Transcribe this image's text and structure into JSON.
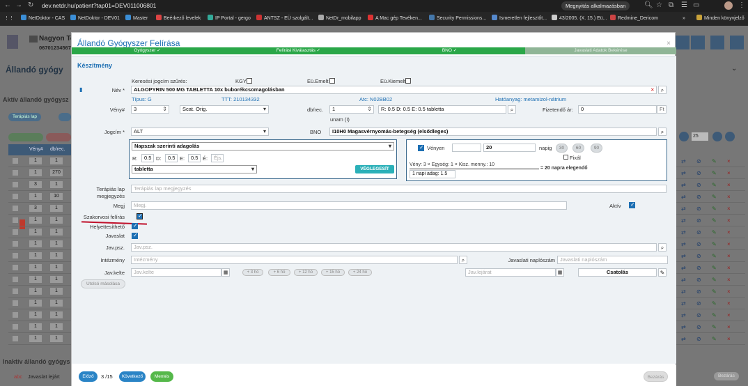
{
  "browser": {
    "url": "dev.netdr.hu/patient?tap01=DEV011006801",
    "open_in_app": "Megnyitás alkalmazásban",
    "bookmarks": [
      "NetDoktor - CAS",
      "NetDoktor - DEV01",
      "Master",
      "Beérkező levelek",
      "IP Portal - gergo",
      "ANTSZ - EÜ szolgált...",
      "NetDr_mobilapp",
      "A Mac gép Tevéken...",
      "Security Permissions...",
      "Ismeretlen fejlesztőt...",
      "43/2005. (X. 15.) Eü...",
      "Redmine_Dericom"
    ],
    "all_bookmarks": "Minden könyvjelző"
  },
  "bg": {
    "patient_name": "Nagyon Te",
    "patient_phone": "06701234567",
    "page_title": "Állandó gyógy",
    "section_title": "Aktív állandó gyógysz",
    "therapy_btn": "Terápiás lap",
    "col_veny": "Vény#",
    "col_db": "db/rec.",
    "inactive_title": "Inaktív állandó gyógys",
    "legend_abc": "abc",
    "legend_text": "Javaslat lejárt",
    "pagesize": "25",
    "close_btn": "Bezárás",
    "rows": [
      [
        "1",
        "1"
      ],
      [
        "1",
        "270"
      ],
      [
        "3",
        "1"
      ],
      [
        "1",
        "10"
      ],
      [
        "3",
        "1"
      ],
      [
        "1",
        "1"
      ],
      [
        "1",
        "1"
      ],
      [
        "1",
        "1"
      ],
      [
        "1",
        "1"
      ],
      [
        "1",
        "1"
      ],
      [
        "1",
        "1"
      ],
      [
        "1",
        "1"
      ],
      [
        "1",
        "1"
      ],
      [
        "1",
        "1"
      ],
      [
        "1",
        "1"
      ],
      [
        "1",
        "1"
      ]
    ]
  },
  "modal": {
    "title": "Állandó Gyógyszer Felírása",
    "close": "×",
    "steps": [
      "Gyógyszer ✓",
      "Felírási Kiválasztás ✓",
      "BNO ✓",
      "Javaslati Adatok Bekérése"
    ],
    "section": "Készítmény",
    "kereses_label": "Keresési jogcím szűrés:",
    "kgy": "KGY",
    "eu_emelt": "Eü.Emelt",
    "eu_kiemelt": "Eü.Kiemelt",
    "nev_label": "Név *",
    "nev_value": "ALGOPYRIN 500 MG TABLETTA 10x buborékcsomagolásban",
    "tipus": "Típus: G",
    "ttt": "TTT: 210134332",
    "atc": "Atc: N02BB02",
    "hatoanyag": "Hatóanyag: metamizol-nátrium",
    "veny_label": "Vény#",
    "veny_value": "3",
    "veny_type": "Scat. Orig.",
    "dbrec_label": "db/rec.",
    "dbrec_value": "1",
    "unam": "unam (I)",
    "adagolas_value": "R: 0.5 D: 0.5 E: 0.5 tabletta",
    "fizetendo_label": "Fizetendő ár:",
    "fizetendo_value": "0",
    "fizetendo_unit": "Ft",
    "jogcim_label": "Jogcím *",
    "jogcim_value": "ALT",
    "bno_label": "BNO",
    "bno_value": "I10H0 Magasvérnyomás-betegség (elsődleges)",
    "dosing": {
      "mode": "Napszak szerinti adagolás",
      "r_label": "R:",
      "r": "0.5",
      "d_label": "D:",
      "d": "0.5",
      "e_label": "E:",
      "e": "0.5",
      "e2_label": "É:",
      "e2_ph": "Éjs.",
      "unit": "tabletta",
      "finalize": "VÉGLEGESÍT"
    },
    "calc": {
      "venyen": "Vényen",
      "napig_value": "20",
      "napig": "napig",
      "d30": "30",
      "d60": "60",
      "d90": "90",
      "fixal": "Fixál",
      "formula": "Vény: 3 × Egység: 1 × Kisz. menny.: 10",
      "result": "= 20 napra elegendő",
      "napi_adag": "1 napi adag: 1.5"
    },
    "terapias_label": "Terápiás lap megjegyzés",
    "terapias_ph": "Terápiás lap megjegyzés",
    "megj_label": "Megj",
    "megj_ph": "Megj.",
    "aktiv_label": "Aktív",
    "szakorvosi_label": "Szakorvosi felírás",
    "helyettesitheto_label": "Helyettesíthető",
    "javaslat_label": "Javaslat",
    "javpsz_label": "Jav.psz.",
    "javpsz_ph": "Jav.psz.",
    "intezmeny_label": "Intézmény",
    "intezmeny_ph": "Intézmény",
    "naplo_label": "Javaslati naplószám",
    "naplo_ph": "Javaslati naplószám",
    "javkelte_label": "Jav.kelte",
    "javkelte_ph": "Jav.kelte",
    "periods": [
      "+ 3 hó",
      "+ 6 hó",
      "+ 12 hó",
      "+ 15 hó",
      "+ 24 hó"
    ],
    "javlejarat_ph": "Jav.lejárat",
    "csatolas": "Csatolás",
    "utolso": "Utolsó másolása",
    "footer": {
      "prev": "Előző",
      "page": "3 /15",
      "next": "Következő",
      "save": "Mentés",
      "close": "Bezárás"
    }
  }
}
